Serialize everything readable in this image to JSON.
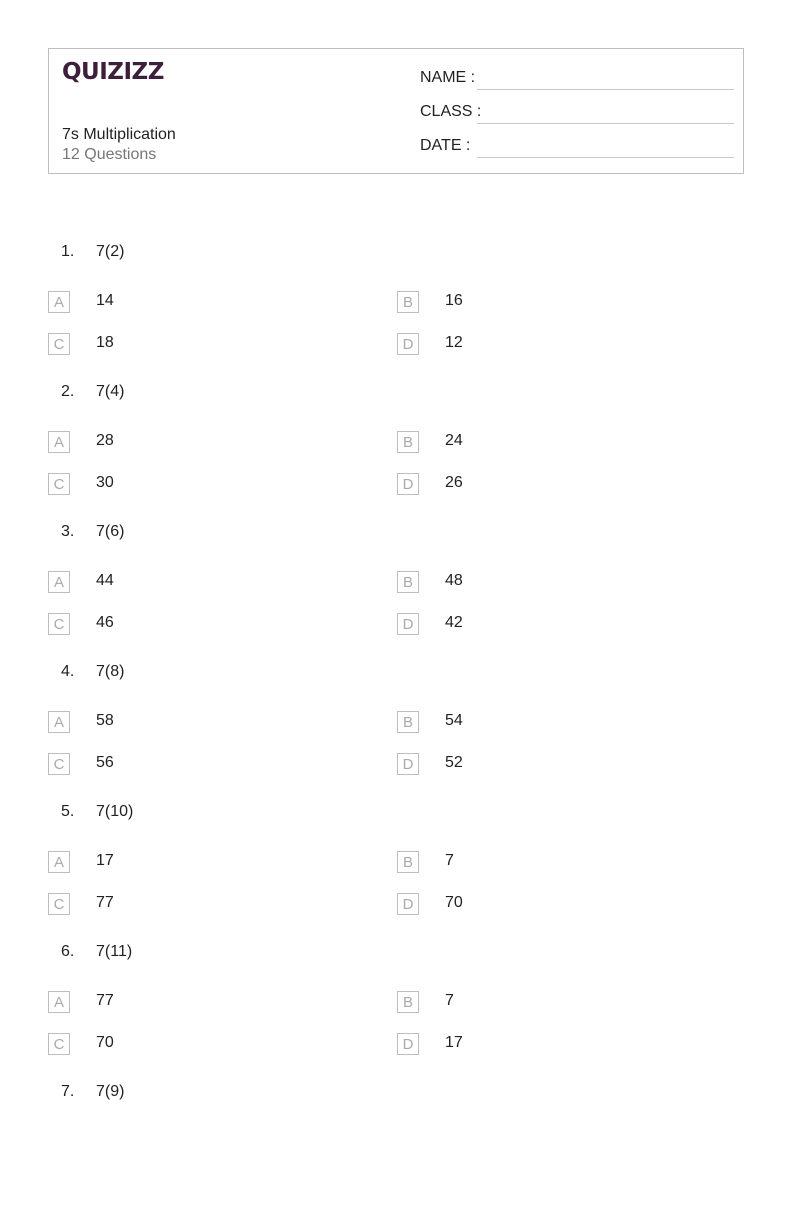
{
  "header": {
    "logo": "QUIZIZZ",
    "title": "7s Multiplication",
    "subtitle": "12 Questions",
    "fields": [
      {
        "label": "NAME :"
      },
      {
        "label": "CLASS :"
      },
      {
        "label": "DATE  :"
      }
    ]
  },
  "questions": [
    {
      "number": "1.",
      "text": "7(2)",
      "options": [
        {
          "letter": "A",
          "text": "14"
        },
        {
          "letter": "B",
          "text": "16"
        },
        {
          "letter": "C",
          "text": "18"
        },
        {
          "letter": "D",
          "text": "12"
        }
      ]
    },
    {
      "number": "2.",
      "text": "7(4)",
      "options": [
        {
          "letter": "A",
          "text": "28"
        },
        {
          "letter": "B",
          "text": "24"
        },
        {
          "letter": "C",
          "text": "30"
        },
        {
          "letter": "D",
          "text": "26"
        }
      ]
    },
    {
      "number": "3.",
      "text": "7(6)",
      "options": [
        {
          "letter": "A",
          "text": "44"
        },
        {
          "letter": "B",
          "text": "48"
        },
        {
          "letter": "C",
          "text": "46"
        },
        {
          "letter": "D",
          "text": "42"
        }
      ]
    },
    {
      "number": "4.",
      "text": "7(8)",
      "options": [
        {
          "letter": "A",
          "text": "58"
        },
        {
          "letter": "B",
          "text": "54"
        },
        {
          "letter": "C",
          "text": "56"
        },
        {
          "letter": "D",
          "text": "52"
        }
      ]
    },
    {
      "number": "5.",
      "text": "7(10)",
      "options": [
        {
          "letter": "A",
          "text": "17"
        },
        {
          "letter": "B",
          "text": "7"
        },
        {
          "letter": "C",
          "text": "77"
        },
        {
          "letter": "D",
          "text": "70"
        }
      ]
    },
    {
      "number": "6.",
      "text": "7(11)",
      "options": [
        {
          "letter": "A",
          "text": "77"
        },
        {
          "letter": "B",
          "text": "7"
        },
        {
          "letter": "C",
          "text": "70"
        },
        {
          "letter": "D",
          "text": "17"
        }
      ]
    },
    {
      "number": "7.",
      "text": "7(9)",
      "options": []
    }
  ]
}
